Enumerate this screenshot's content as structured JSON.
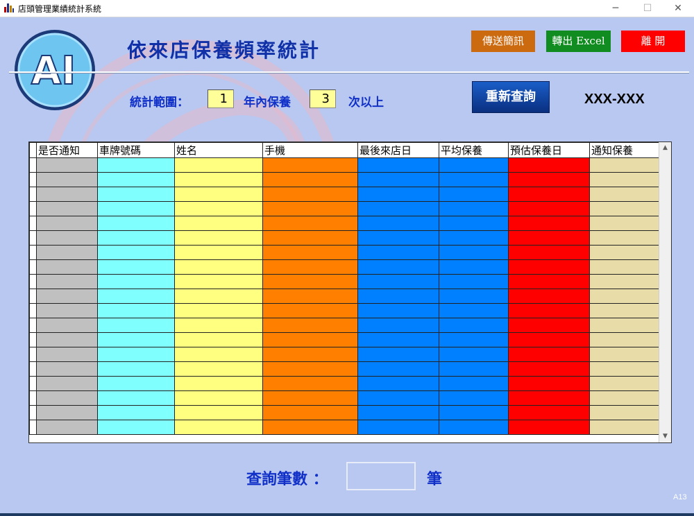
{
  "window": {
    "title": "店頭管理業績統計系統",
    "minimize": "─",
    "maximize": "☐",
    "close": "✕"
  },
  "header": {
    "title": "依來店保養頻率統計",
    "logo_text": "AI",
    "buttons": {
      "send_sms": "傳送簡訊",
      "export_excel": "轉出 Excel",
      "exit": "離 開"
    },
    "button_colors": {
      "send_sms": "#cc6a10",
      "export_excel": "#108c20",
      "exit": "#ff0000"
    }
  },
  "filter": {
    "range_label": "統計範圍：",
    "years": "1",
    "years_suffix": "年內保養",
    "times": "3",
    "times_suffix": "次以上",
    "requery_button": "重新查詢",
    "code": "XXX-XXX"
  },
  "grid": {
    "columns": [
      {
        "label": "是否通知",
        "color": "#c0c0c0"
      },
      {
        "label": "車牌號碼",
        "color": "#80ffff"
      },
      {
        "label": "姓名",
        "color": "#ffff80"
      },
      {
        "label": "手機",
        "color": "#ff8000"
      },
      {
        "label": "最後來店日",
        "color": "#0080ff"
      },
      {
        "label": "平均保養",
        "color": "#0080ff"
      },
      {
        "label": "預估保養日",
        "color": "#ff0000"
      },
      {
        "label": "通知保養",
        "color": "#e8dca8"
      }
    ],
    "row_count": 19
  },
  "footer": {
    "count_label": "查詢筆數 ：",
    "count_value": "",
    "count_unit": "筆",
    "form_code": "A13"
  }
}
